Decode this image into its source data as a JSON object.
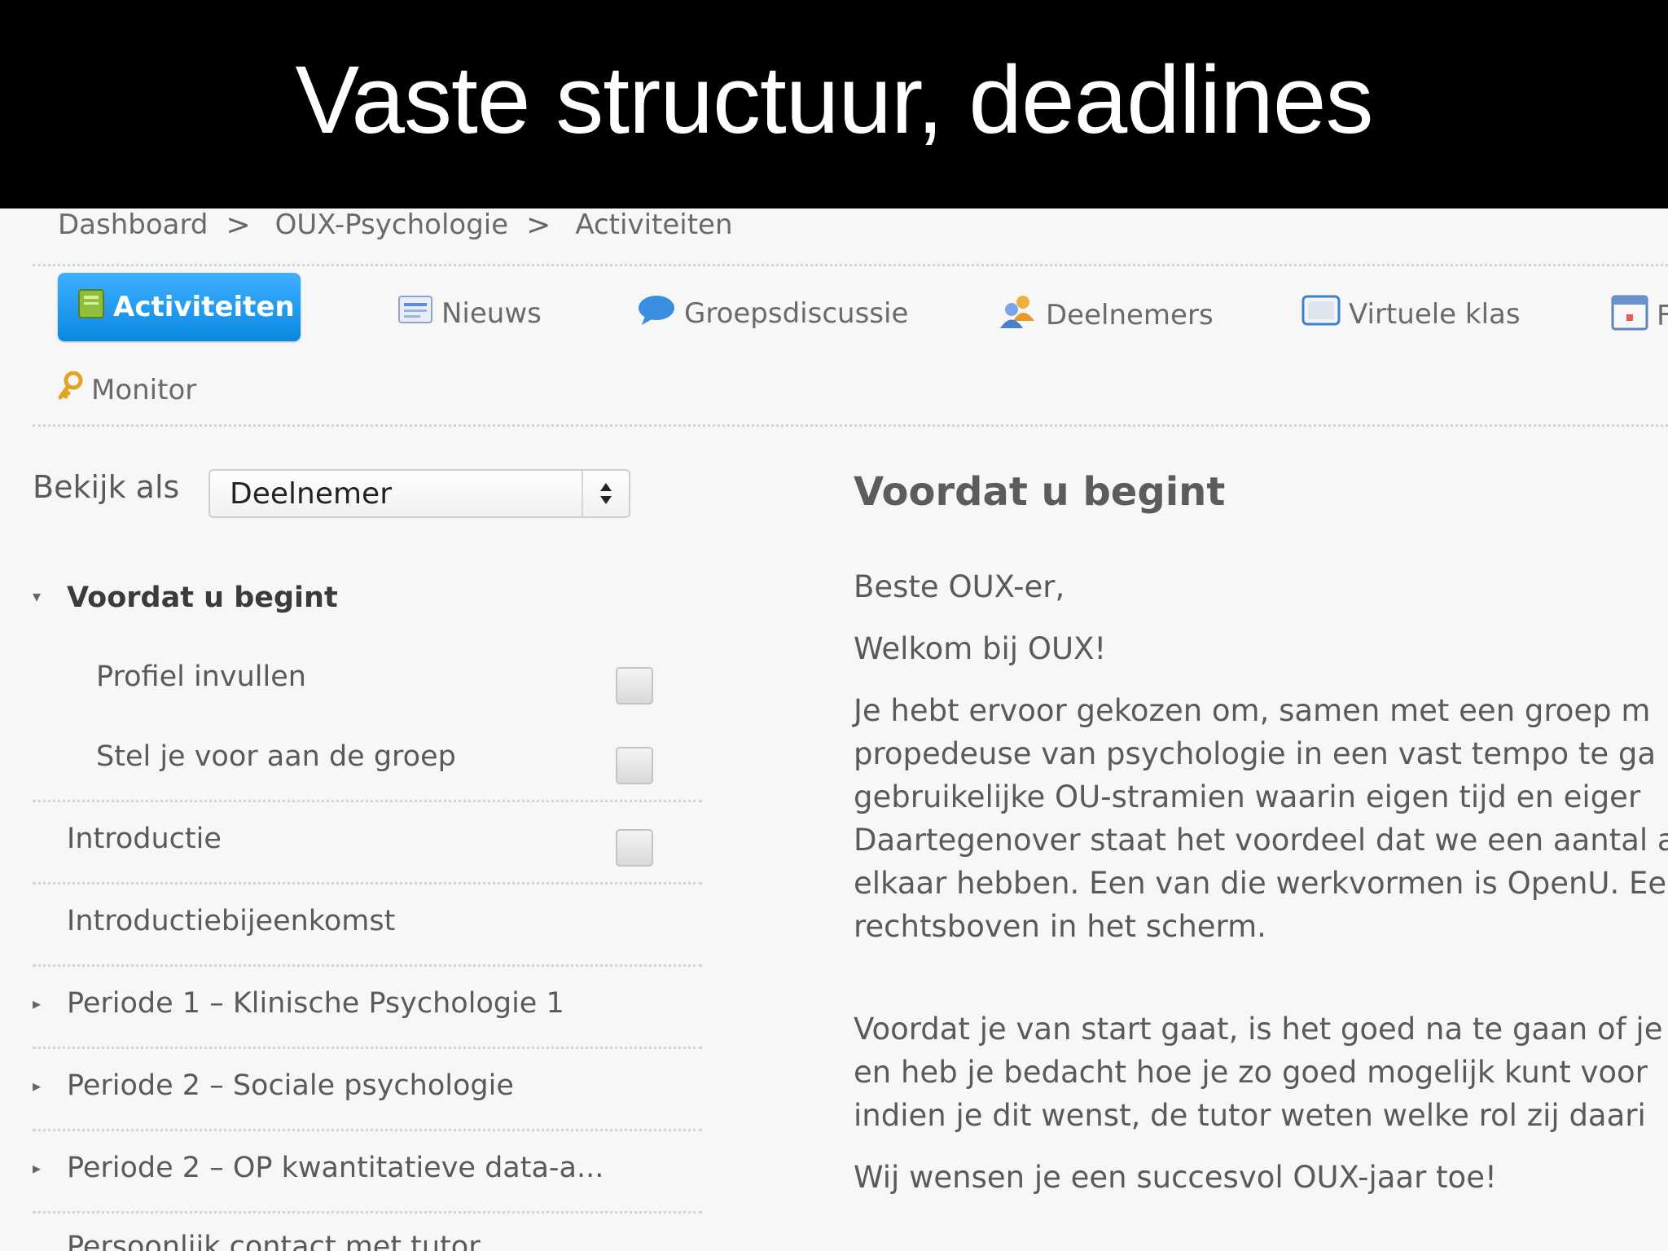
{
  "slide": {
    "title": "Vaste structuur, deadlines"
  },
  "breadcrumb": {
    "items": [
      "Dashboard",
      "OUX-Psychologie",
      "Activiteiten"
    ],
    "separator": ">"
  },
  "tabs": [
    {
      "label": "Activiteiten",
      "icon": "book-icon",
      "active": true
    },
    {
      "label": "Nieuws",
      "icon": "news-icon"
    },
    {
      "label": "Groepsdiscussie",
      "icon": "speech-bubble-icon"
    },
    {
      "label": "Deelnemers",
      "icon": "users-icon"
    },
    {
      "label": "Virtuele klas",
      "icon": "screen-icon"
    },
    {
      "label": "F",
      "icon": "calendar-icon"
    },
    {
      "label": "Monitor",
      "icon": "key-icon"
    }
  ],
  "view_as": {
    "label": "Bekijk als",
    "selected": "Deelnemer"
  },
  "sidebar": {
    "section": {
      "label": "Voordat u begint",
      "expanded": true
    },
    "sub_items": [
      {
        "label": "Profiel invullen",
        "checked": false
      },
      {
        "label": "Stel je voor aan de groep",
        "checked": false
      }
    ],
    "items": [
      {
        "label": "Introductie",
        "checkbox": true,
        "checked": false
      },
      {
        "label": "Introductiebijeenkomst"
      },
      {
        "label": "Periode 1 – Klinische Psychologie 1",
        "collapsed": true
      },
      {
        "label": "Periode 2 – Sociale psychologie",
        "collapsed": true
      },
      {
        "label": "Periode 2 – OP kwantitatieve data-a...",
        "collapsed": true
      },
      {
        "label": "Persoonlijk contact met tutor"
      }
    ]
  },
  "content": {
    "title": "Voordat u begint",
    "greeting": "Beste OUX-er,",
    "welcome": "Welkom bij OUX!",
    "paragraph1": [
      "Je hebt ervoor gekozen om, samen met een groep m",
      "propedeuse van psychologie in een vast tempo te ga",
      "gebruikelijke OU-stramien waarin eigen tijd en eiger",
      "Daartegenover staat het voordeel dat we een aantal a",
      "elkaar hebben. Een van die werkvormen is OpenU. Ee",
      "rechtsboven in het scherm."
    ],
    "paragraph2": [
      "Voordat je van start gaat, is het goed na te gaan of je",
      "en heb je bedacht hoe je zo goed mogelijk kunt voor",
      "indien je dit wenst, de tutor weten welke rol zij daari"
    ],
    "closing": "Wij wensen je een succesvol OUX-jaar toe!"
  },
  "colors": {
    "tab_active": "#1a96f0",
    "title_bar": "#000000"
  }
}
